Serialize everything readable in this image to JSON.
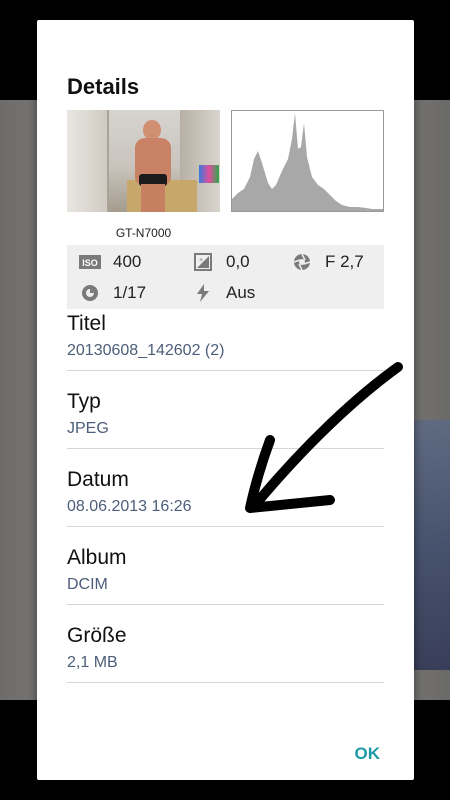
{
  "dialog": {
    "title": "Details",
    "model": "GT-N7000",
    "exif": {
      "iso": {
        "icon": "iso-icon",
        "value": "400"
      },
      "exposure": {
        "icon": "exposure-icon",
        "value": "0,0"
      },
      "aperture": {
        "icon": "aperture-icon",
        "value": "F 2,7"
      },
      "shutter": {
        "icon": "shutter-icon",
        "value": "1/17"
      },
      "flash": {
        "icon": "flash-icon",
        "value": "Aus"
      }
    },
    "details": [
      {
        "label": "Titel",
        "value": "20130608_142602 (2)"
      },
      {
        "label": "Typ",
        "value": "JPEG"
      },
      {
        "label": "Datum",
        "value": "08.06.2013 16:26"
      },
      {
        "label": "Album",
        "value": "DCIM"
      },
      {
        "label": "Größe",
        "value": "2,1 MB"
      }
    ],
    "ok_label": "OK"
  },
  "colors": {
    "accent": "#1b9aa5",
    "value_text": "#4c5e79",
    "histogram": "#a8a8a8"
  }
}
